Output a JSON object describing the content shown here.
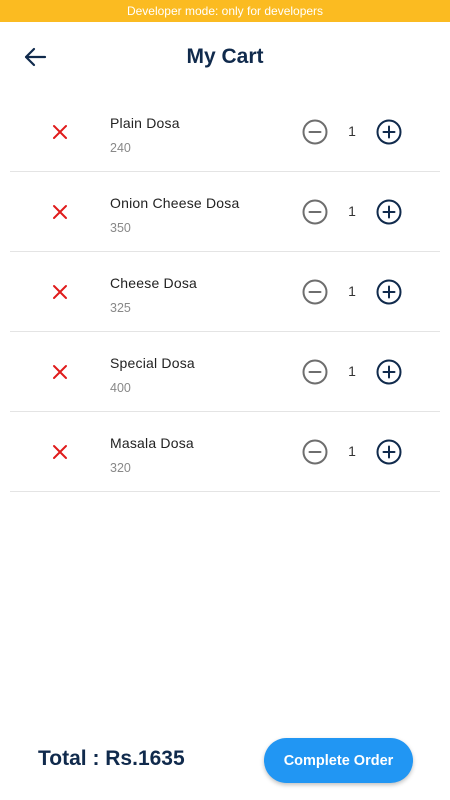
{
  "banner": {
    "text": "Developer mode: only for developers",
    "color": "#fbbb21"
  },
  "header": {
    "title": "My Cart",
    "back_icon": "arrow-left-icon"
  },
  "cart": {
    "items": [
      {
        "name": "Plain Dosa",
        "price": "240",
        "quantity": "1"
      },
      {
        "name": "Onion Cheese Dosa",
        "price": "350",
        "quantity": "1"
      },
      {
        "name": "Cheese Dosa",
        "price": "325",
        "quantity": "1"
      },
      {
        "name": "Special Dosa",
        "price": "400",
        "quantity": "1"
      },
      {
        "name": "Masala Dosa",
        "price": "320",
        "quantity": "1"
      }
    ],
    "icons": {
      "remove": "close-icon",
      "decrease": "minus-circle-icon",
      "increase": "plus-circle-icon"
    }
  },
  "footer": {
    "total_label": "Total : Rs.1635",
    "complete_button_label": "Complete Order"
  },
  "colors": {
    "primary_text": "#102a4c",
    "remove_red": "#e01b1b",
    "button_blue": "#2196f3",
    "minus_gray": "#6e6e6e"
  }
}
